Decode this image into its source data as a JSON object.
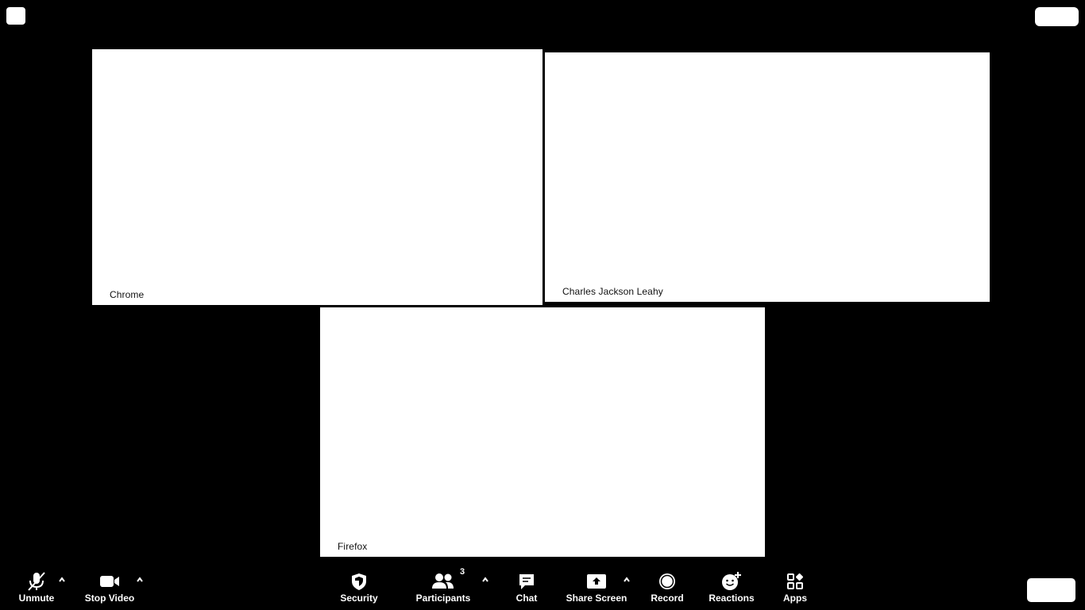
{
  "participants": [
    {
      "name": "Chrome"
    },
    {
      "name": "Charles Jackson Leahy"
    },
    {
      "name": "Firefox"
    }
  ],
  "toolbar": {
    "unmute": "Unmute",
    "stop_video": "Stop Video",
    "security": "Security",
    "participants": "Participants",
    "participant_count": "3",
    "chat": "Chat",
    "share_screen": "Share Screen",
    "record": "Record",
    "reactions": "Reactions",
    "apps": "Apps"
  },
  "colors": {
    "background": "#000000",
    "tile": "#ffffff",
    "toolbar_text": "#ffffff"
  },
  "icons": {
    "unmute": "microphone-muted-icon",
    "stop_video": "video-camera-icon",
    "security": "shield-icon",
    "participants": "people-icon",
    "chat": "chat-bubble-icon",
    "share_screen": "share-screen-icon",
    "record": "record-icon",
    "reactions": "emoji-plus-icon",
    "apps": "apps-icon",
    "caret": "caret-up-icon"
  }
}
